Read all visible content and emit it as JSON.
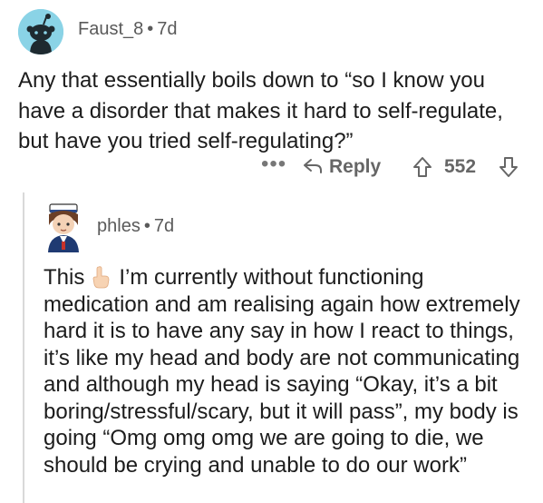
{
  "comments": [
    {
      "username": "Faust_8",
      "separator": "•",
      "age": "7d",
      "avatar_icon": "reddit-snoo-avatar",
      "text": "Any that essentially boils down to “so I know you have a disorder that makes it hard to self-regulate, but have you tried self-regulating?”",
      "actions": {
        "more_label": "•••",
        "reply_label": "Reply",
        "score": "552"
      }
    },
    {
      "username": "phles",
      "separator": "•",
      "age": "7d",
      "avatar_icon": "sailor-character-avatar",
      "text_before_emoji": "This",
      "emoji_icon": "backhand-index-pointing-up-emoji",
      "text_after_emoji": "I’m currently without functioning medication and am realising again how extremely hard it is to have any say in how I react to things, it’s like my head and body are not communicating and although my head is saying “Okay, it’s a bit boring/stressful/scary, but it will pass”, my body is going “Omg omg omg we are going to die, we should be crying and unable to do our work”"
    }
  ],
  "colors": {
    "avatar1_bg": "#8ad3e6",
    "text": "#1c1c1c",
    "meta": "#5a5a5a",
    "thread_line": "#d9d9d9"
  }
}
